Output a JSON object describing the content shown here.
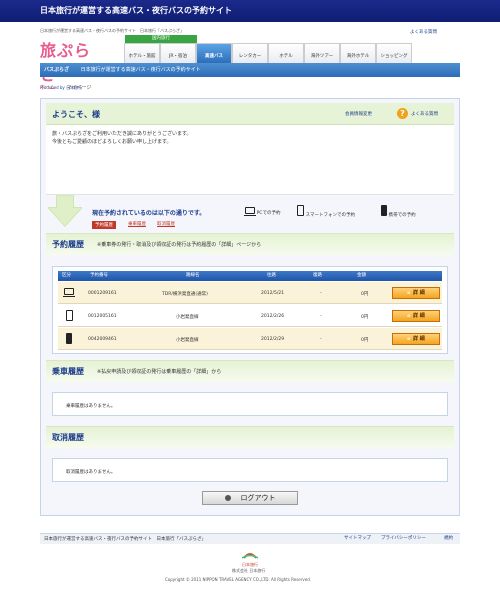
{
  "banner": {
    "title": "日本旅行が運営する高速バス・夜行バスの予約サイト"
  },
  "header": {
    "tagline": "日本旅行が運営する高速バス・夜行バスの予約サイト　日本旅行「バスぷらざ」",
    "help_link": "よくある質問",
    "logo_text": "旅ぷらざ",
    "logo_sub": "Produced by 日本旅行"
  },
  "nav": {
    "group_label": "国内旅行",
    "items": [
      {
        "label": "ホテル・旅館"
      },
      {
        "label": "JR・宿泊"
      },
      {
        "label": "高速バス"
      },
      {
        "label": "レンタカー"
      },
      {
        "label": "ホテル"
      },
      {
        "label": "海外ツアー"
      },
      {
        "label": "海外ホテル"
      },
      {
        "label": "ショッピング"
      }
    ]
  },
  "subheader": {
    "brand": "バスぷらざ",
    "text": "日本旅行が運営する高速バス・夜行バスの予約サイト"
  },
  "breadcrumb": {
    "home": "ホーム",
    "current": "マイページ"
  },
  "welcome": {
    "title": "ようこそ、様",
    "member_change": "会員情報変更",
    "faq": "よくある質問",
    "message1": "旅・バスぷらざをご利用いただき誠にありがとうございます。",
    "message2": "今後ともご愛顧のほどよろしくお願い申し上げます。"
  },
  "reservations": {
    "heading": "現在予約されているのは以下の通りです。",
    "device_pc": "PCでの予約",
    "device_sp": "スマートフォンでの予約",
    "device_mobile": "携帯での予約",
    "filter_all": "予約履歴",
    "filter_ride": "乗車履歴",
    "filter_cancel": "取消履歴"
  },
  "history": {
    "title": "予約履歴",
    "note": "※乗車券の発行・取消及び領収証の発行は予約履歴の「詳細」ページから",
    "columns": [
      "区分",
      "予約番号",
      "路線名",
      "往路",
      "復路",
      "金額"
    ],
    "rows": [
      {
        "device": "pc",
        "number": "0001209161",
        "route": "TDR/横浜発直通(通常)",
        "outbound": "2012/5/21",
        "return": "-",
        "amount": "0円",
        "button": "詳 細"
      },
      {
        "device": "sp",
        "number": "0012005161",
        "route": "小岩発直線",
        "outbound": "2012/2/26",
        "return": "-",
        "amount": "0円",
        "button": "詳 細"
      },
      {
        "device": "mobile",
        "number": "0042009461",
        "route": "小岩発直線",
        "outbound": "2012/2/29",
        "return": "-",
        "amount": "0円",
        "button": "詳 細"
      }
    ]
  },
  "ride": {
    "title": "乗車履歴",
    "note": "※払戻申請及び領収証の発行は乗車履歴の「詳細」から",
    "empty": "乗車履歴はありません。"
  },
  "cancel": {
    "title": "取消履歴",
    "empty": "取消履歴はありません。"
  },
  "logout": {
    "label": "ログアウト"
  },
  "footer": {
    "tagline": "日本旅行が運営する高速バス・夜行バスの予約サイト　日本旅行「バスぷらざ」",
    "sitemap": "サイトマップ",
    "privacy": "プライバシーポリシー",
    "terms": "規約",
    "logo": "日本旅行",
    "company": "株式会社 日本旅行",
    "copyright": "Copyright © 2011 NIPPON TRAVEL AGENCY CO.,LTD. All Rights Reserved."
  },
  "colors": {
    "brand_blue": "#1b2a8c",
    "section_green": "#e5f2d3",
    "detail_orange": "#f5a51f",
    "filter_red": "#c0392b"
  }
}
